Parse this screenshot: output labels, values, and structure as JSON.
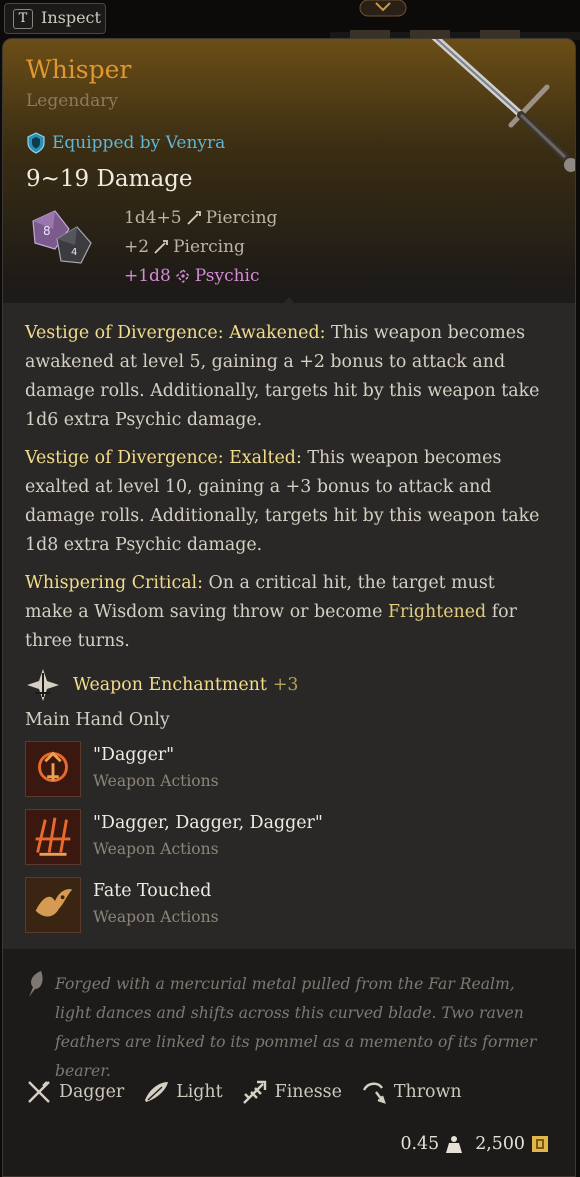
{
  "inspect": {
    "key": "T",
    "label": "Inspect"
  },
  "item": {
    "name": "Whisper",
    "rarity": "Legendary",
    "equipped_by": "Equipped by Venyra",
    "damage_total": "9~19 Damage",
    "damage_rows": [
      {
        "amount": "1d4+5",
        "type": "Piercing"
      },
      {
        "amount": "+2",
        "type": "Piercing"
      },
      {
        "amount": "+1d8",
        "type": "Psychic"
      }
    ]
  },
  "passives": [
    {
      "name": "Vestige of Divergence: Awakened:",
      "text": " This weapon becomes awakened at level 5, gaining a +2 bonus to attack and damage rolls. Additionally, targets hit by this weapon take 1d6 extra Psychic damage."
    },
    {
      "name": "Vestige of Divergence: Exalted:",
      "text": " This weapon becomes exalted at level 10, gaining a +3 bonus to attack and damage rolls. Additionally, targets hit by this weapon take 1d8 extra Psychic damage."
    },
    {
      "name": "Whispering Critical:",
      "text_before": " On a critical hit, the target must make a Wisdom saving throw or become ",
      "keyword": "Frightened",
      "text_after": " for three turns."
    }
  ],
  "enchantment": {
    "label": "Weapon Enchantment",
    "bonus": "+3"
  },
  "main_hand_only": "Main Hand Only",
  "actions": [
    {
      "name": "\"Dagger\"",
      "type": "Weapon Actions",
      "icon": "dagger-action-icon"
    },
    {
      "name": "\"Dagger, Dagger, Dagger\"",
      "type": "Weapon Actions",
      "icon": "triple-dagger-action-icon"
    },
    {
      "name": "Fate Touched",
      "type": "Weapon Actions",
      "icon": "raven-fate-icon"
    }
  ],
  "flavor": "Forged with a mercurial metal pulled from the Far Realm, light dances and shifts across this curved blade. Two raven feathers are linked to its pommel as a memento of its former bearer.",
  "properties": [
    {
      "label": "Dagger",
      "icon": "dagger-icon"
    },
    {
      "label": "Light",
      "icon": "feather-icon"
    },
    {
      "label": "Finesse",
      "icon": "finesse-icon"
    },
    {
      "label": "Thrown",
      "icon": "thrown-icon"
    }
  ],
  "footer": {
    "weight": "0.45",
    "value": "2,500"
  },
  "colors": {
    "legendary": "#e0982e",
    "psychic": "#d48ad6",
    "highlight": "#f3dc8a",
    "equipped": "#5fb6d6"
  }
}
